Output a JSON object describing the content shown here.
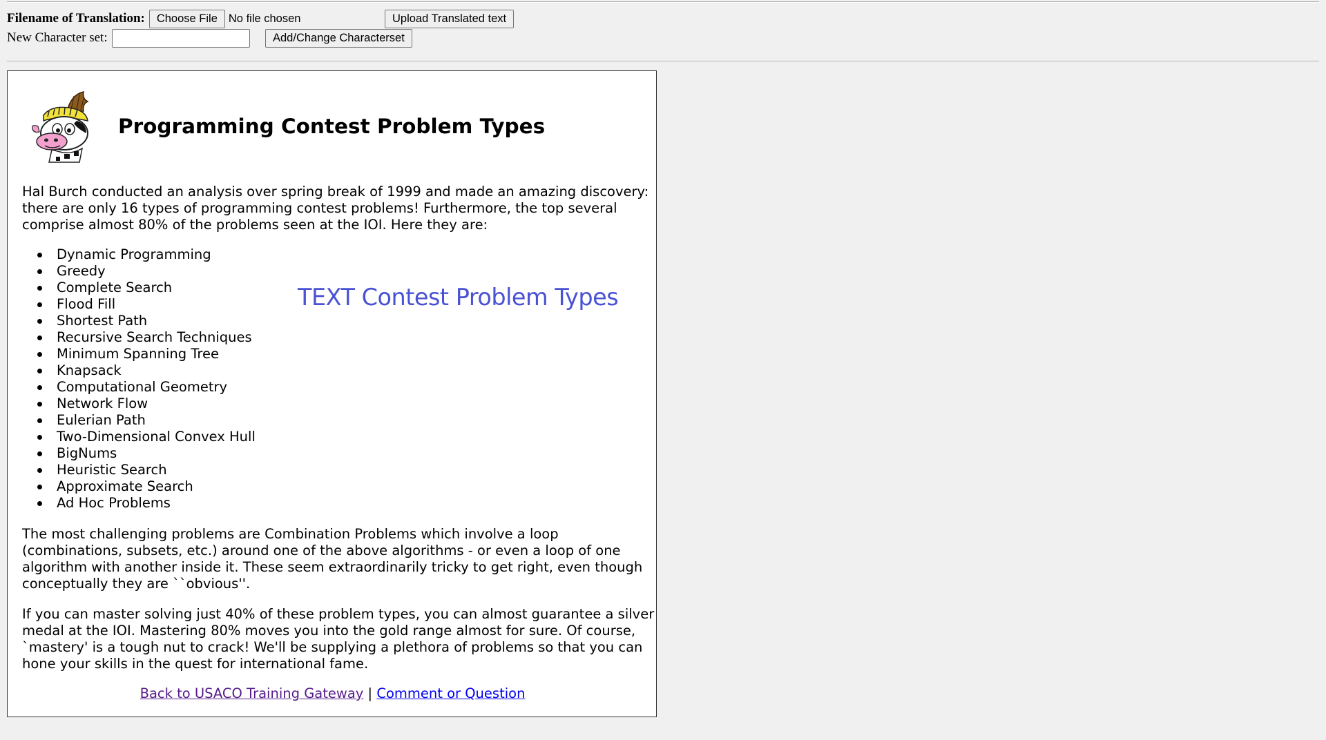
{
  "upload_form": {
    "filename_label": "Filename of Translation:",
    "choose_file_label": "Choose File",
    "file_status": "No file chosen",
    "upload_label": "Upload Translated text",
    "charset_label": "New Character set:",
    "charset_value": "",
    "charset_button_label": "Add/Change Characterset"
  },
  "article": {
    "title": "Programming Contest Problem Types",
    "intro": "Hal Burch conducted an analysis over spring break of 1999 and made an amazing discovery: there are only 16 types of programming contest problems! Furthermore, the top several comprise almost 80% of the problems seen at the IOI. Here they are:",
    "problem_types": [
      "Dynamic Programming",
      "Greedy",
      "Complete Search",
      "Flood Fill",
      "Shortest Path",
      "Recursive Search Techniques",
      "Minimum Spanning Tree",
      "Knapsack",
      "Computational Geometry",
      "Network Flow",
      "Eulerian Path",
      "Two-Dimensional Convex Hull",
      "BigNums",
      "Heuristic Search",
      "Approximate Search",
      "Ad Hoc Problems"
    ],
    "overlay_text": "TEXT Contest Problem Types",
    "overlay_color": "#4a52d4",
    "combination_paragraph": "The most challenging problems are Combination Problems which involve a loop (combinations, subsets, etc.) around one of the above algorithms - or even a loop of one algorithm with another inside it. These seem extraordinarily tricky to get right, even though conceptually they are ``obvious''.",
    "mastery_paragraph": "If you can master solving just 40% of these problem types, you can almost guarantee a silver medal at the IOI. Mastering 80% moves you into the gold range almost for sure. Of course, `mastery' is a tough nut to crack! We'll be supplying a plethora of problems so that you can hone your skills in the quest for international fame."
  },
  "footer": {
    "gateway_link": "Back to USACO Training Gateway",
    "separator": "|",
    "comment_link": "Comment or Question"
  },
  "colors": {
    "link": "#0000ee",
    "visited_link": "#551a8b",
    "page_background": "#f0f0f0"
  }
}
